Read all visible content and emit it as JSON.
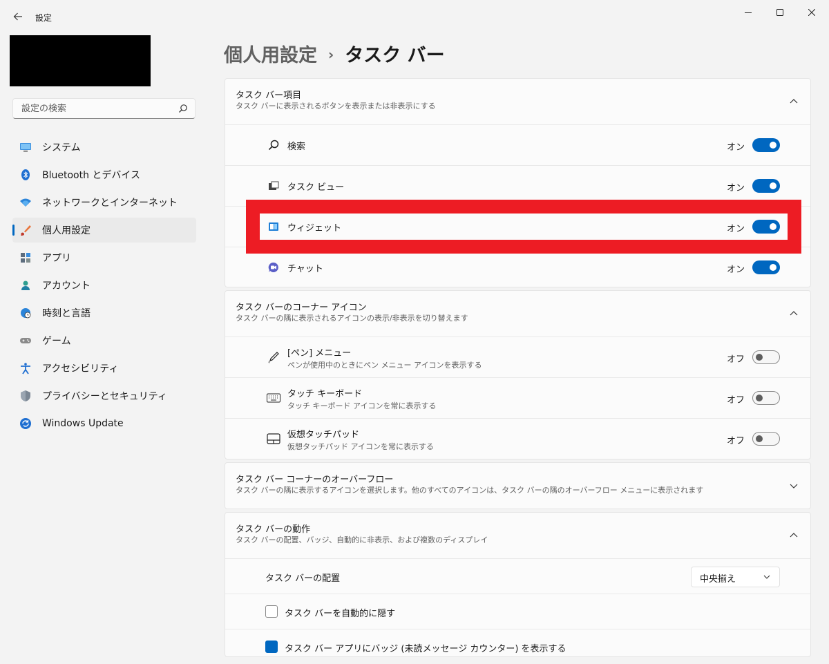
{
  "app": {
    "title": "設定"
  },
  "search": {
    "placeholder": "設定の検索"
  },
  "nav": [
    {
      "label": "システム",
      "icon": "monitor-icon"
    },
    {
      "label": "Bluetooth とデバイス",
      "icon": "bluetooth-icon"
    },
    {
      "label": "ネットワークとインターネット",
      "icon": "wifi-icon"
    },
    {
      "label": "個人用設定",
      "icon": "paintbrush-icon",
      "selected": true
    },
    {
      "label": "アプリ",
      "icon": "apps-icon"
    },
    {
      "label": "アカウント",
      "icon": "person-icon"
    },
    {
      "label": "時刻と言語",
      "icon": "globe-clock-icon"
    },
    {
      "label": "ゲーム",
      "icon": "gamepad-icon"
    },
    {
      "label": "アクセシビリティ",
      "icon": "accessibility-icon"
    },
    {
      "label": "プライバシーとセキュリティ",
      "icon": "shield-icon"
    },
    {
      "label": "Windows Update",
      "icon": "update-icon"
    }
  ],
  "breadcrumb": {
    "parent": "個人用設定",
    "separator": "›",
    "current": "タスク バー"
  },
  "sections": {
    "items": {
      "title": "タスク バー項目",
      "subtitle": "タスク バーに表示されるボタンを表示または非表示にする",
      "rows": [
        {
          "label": "検索",
          "state": "オン",
          "icon": "search-icon"
        },
        {
          "label": "タスク ビュー",
          "state": "オン",
          "icon": "task-view-icon"
        },
        {
          "label": "ウィジェット",
          "state": "オン",
          "icon": "widgets-icon"
        },
        {
          "label": "チャット",
          "state": "オン",
          "icon": "chat-icon"
        }
      ]
    },
    "corner": {
      "title": "タスク バーのコーナー アイコン",
      "subtitle": "タスク バーの隅に表示されるアイコンの表示/非表示を切り替えます",
      "rows": [
        {
          "label": "[ペン] メニュー",
          "desc": "ペンが使用中のときにペン メニュー アイコンを表示する",
          "state": "オフ",
          "icon": "pen-icon"
        },
        {
          "label": "タッチ キーボード",
          "desc": "タッチ キーボード アイコンを常に表示する",
          "state": "オフ",
          "icon": "keyboard-icon"
        },
        {
          "label": "仮想タッチパッド",
          "desc": "仮想タッチパッド アイコンを常に表示する",
          "state": "オフ",
          "icon": "touchpad-icon"
        }
      ]
    },
    "overflow": {
      "title": "タスク バー コーナーのオーバーフロー",
      "subtitle": "タスク バーの隅に表示するアイコンを選択します。他のすべてのアイコンは、タスク バーの隅のオーバーフロー メニューに表示されます"
    },
    "behavior": {
      "title": "タスク バーの動作",
      "subtitle": "タスク バーの配置、バッジ、自動的に非表示、および複数のディスプレイ",
      "alignment_label": "タスク バーの配置",
      "alignment_value": "中央揃え",
      "autohide_label": "タスク バーを自動的に隠す",
      "badge_label": "タスク バー アプリにバッジ (未読メッセージ カウンター) を表示する"
    }
  },
  "colors": {
    "accent": "#0067c0",
    "highlight": "#ed1c24"
  }
}
